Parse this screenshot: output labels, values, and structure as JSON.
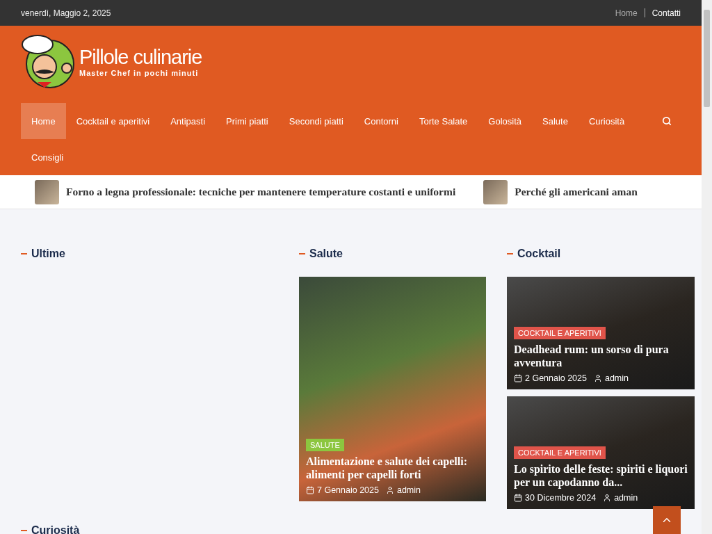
{
  "top_bar": {
    "date": "venerdì, Maggio 2, 2025",
    "links": [
      {
        "label": "Home",
        "selected": true
      },
      {
        "label": "Contatti",
        "selected": false
      }
    ]
  },
  "header": {
    "site_title": "Pillole culinarie",
    "tagline": "Master Chef in pochi minuti"
  },
  "nav": {
    "items": [
      {
        "label": "Home",
        "selected": true
      },
      {
        "label": "Cocktail e aperitivi",
        "selected": false
      },
      {
        "label": "Antipasti",
        "selected": false
      },
      {
        "label": "Primi piatti",
        "selected": false
      },
      {
        "label": "Secondi piatti",
        "selected": false
      },
      {
        "label": "Contorni",
        "selected": false
      },
      {
        "label": "Torte Salate",
        "selected": false
      },
      {
        "label": "Golosità",
        "selected": false
      },
      {
        "label": "Salute",
        "selected": false
      },
      {
        "label": "Curiosità",
        "selected": false
      },
      {
        "label": "Consigli",
        "selected": false
      }
    ]
  },
  "ticker": [
    {
      "title": "Forno a legna professionale: tecniche per mantenere temperature costanti e uniformi"
    },
    {
      "title": "Perché gli americani aman"
    }
  ],
  "sections": [
    {
      "heading": "Ultime"
    },
    {
      "heading": "Salute",
      "posts": [
        {
          "category": "SALUTE",
          "color": "#8cc63f",
          "title": "Alimentazione e salute dei capelli: alimenti per capelli forti",
          "date": "7 Gennaio 2025",
          "author": "admin"
        }
      ]
    },
    {
      "heading": "Cocktail",
      "posts": [
        {
          "category": "COCKTAIL E APERITIVI",
          "color": "#e0544a",
          "title": "Deadhead rum: un sorso di pura avventura",
          "date": "2 Gennaio 2025",
          "author": "admin"
        },
        {
          "category": "COCKTAIL E APERITIVI",
          "color": "#e0544a",
          "title": "Lo spirito delle feste: spiriti e liquori per un capodanno da...",
          "date": "30 Dicembre 2024",
          "author": "admin"
        }
      ]
    }
  ],
  "bottom_heading": "Curiosità"
}
